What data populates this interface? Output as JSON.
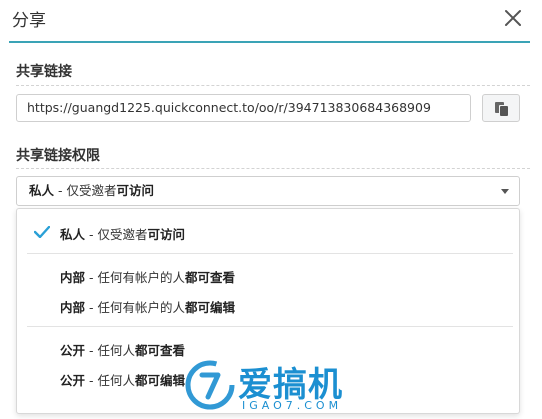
{
  "dialog": {
    "title": "分享"
  },
  "share_link": {
    "label": "共享链接",
    "url": "https://guangd1225.quickconnect.to/oo/r/394713830684368909"
  },
  "permissions": {
    "label": "共享链接权限",
    "selected": {
      "prefix": "私人",
      "sep": " - 仅受邀者",
      "bold": "可访问"
    },
    "options": [
      {
        "prefix": "私人",
        "sep": " - 仅受邀者",
        "bold": "可访问",
        "checked": true
      },
      {
        "prefix": "内部",
        "sep": " - 任何有帐户的人",
        "bold": "都可查看",
        "checked": false
      },
      {
        "prefix": "内部",
        "sep": " - 任何有帐户的人",
        "bold": "都可编辑",
        "checked": false
      },
      {
        "prefix": "公开",
        "sep": " - 任何人",
        "bold": "都可查看",
        "checked": false
      },
      {
        "prefix": "公开",
        "sep": " - 任何人",
        "bold": "都可编辑",
        "checked": false
      }
    ]
  },
  "watermark": {
    "brand": "爱搞机",
    "domain": "IGAO7.COM"
  },
  "colors": {
    "accent": "#3aa3b6",
    "check": "#2aa0d6",
    "watermark": "#1b8fd1"
  },
  "icons": {
    "close": "close-icon",
    "copy": "copy-icon",
    "caret": "chevron-down-icon",
    "check": "check-icon"
  }
}
